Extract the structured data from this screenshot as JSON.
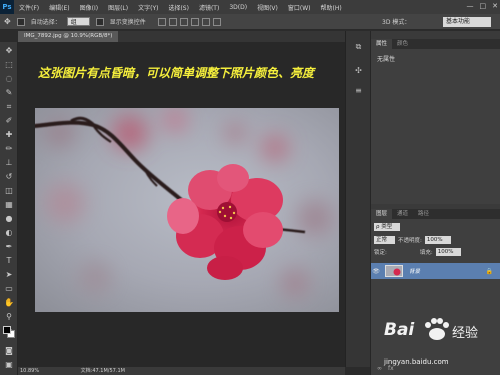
{
  "app": {
    "logo": "Ps"
  },
  "menu": [
    "文件(F)",
    "编辑(E)",
    "图像(I)",
    "图层(L)",
    "文字(Y)",
    "选择(S)",
    "滤镜(T)",
    "3D(D)",
    "视图(V)",
    "窗口(W)",
    "帮助(H)"
  ],
  "window_controls": [
    "—",
    "□",
    "✕"
  ],
  "options": {
    "auto_select_label": "自动选择：",
    "auto_select_value": "组",
    "transform_label": "显示变换控件",
    "mode3d_label": "3D 模式：",
    "workspace": "基本功能"
  },
  "document": {
    "tab_title": "IMG_7892.jpg @ 10.9%(RGB/8*)",
    "caption": "这张图片有点昏暗，可以简单调整下照片颜色、亮度"
  },
  "status": {
    "zoom": "10.89%",
    "doc_size": "文档:47.1M/57.1M"
  },
  "properties_panel": {
    "tabs": [
      "属性",
      "颜色"
    ],
    "body_label": "无属性"
  },
  "layers_panel": {
    "tabs": [
      "图层",
      "通道",
      "路径"
    ],
    "kind_label": "ρ 类型",
    "blend_mode": "正常",
    "opacity_label": "不透明度:",
    "opacity_value": "100%",
    "lock_label": "锁定:",
    "fill_label": "填充:",
    "fill_value": "100%",
    "layer_name": "背景"
  },
  "watermark": {
    "brand": "Bai",
    "brand2": "经验",
    "url": "jingyan.baidu.com"
  },
  "colors": {
    "caption": "#f5ef3c",
    "accent": "#d6284f"
  }
}
